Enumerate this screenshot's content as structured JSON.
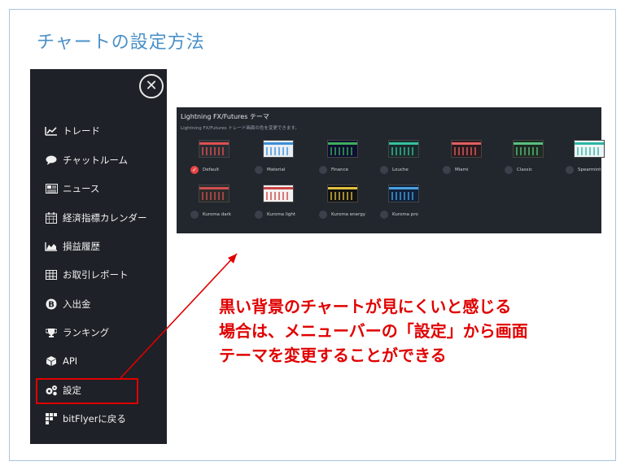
{
  "slide": {
    "title": "チャートの設定方法"
  },
  "sidebar": {
    "close_icon": "close-icon",
    "items": [
      {
        "label": "トレード",
        "icon": "chart-line-icon"
      },
      {
        "label": "チャットルーム",
        "icon": "chat-bubble-icon"
      },
      {
        "label": "ニュース",
        "icon": "newspaper-icon"
      },
      {
        "label": "経済指標カレンダー",
        "icon": "calendar-icon"
      },
      {
        "label": "損益履歴",
        "icon": "area-chart-icon"
      },
      {
        "label": "お取引レポート",
        "icon": "table-icon"
      },
      {
        "label": "入出金",
        "icon": "bitcoin-icon"
      },
      {
        "label": "ランキング",
        "icon": "trophy-icon"
      },
      {
        "label": "API",
        "icon": "cube-icon"
      },
      {
        "label": "設定",
        "icon": "gears-icon"
      },
      {
        "label": "bitFlyerに戻る",
        "icon": "bitflyer-logo-icon"
      }
    ]
  },
  "panel": {
    "title": "Lightning FX/Futures テーマ",
    "subtitle": "Lightning FX/Futures トレード画面の色を変更できます。",
    "themes": [
      {
        "label": "Default",
        "selected": true,
        "bg": "#2a2d33",
        "accent": "#e05050"
      },
      {
        "label": "Material",
        "selected": false,
        "bg": "#e8eef4",
        "accent": "#3d8fd6"
      },
      {
        "label": "Finance",
        "selected": false,
        "bg": "#0d1030",
        "accent": "#3fae5a"
      },
      {
        "label": "Louche",
        "selected": false,
        "bg": "#1a2a2a",
        "accent": "#37c0a0"
      },
      {
        "label": "Miami",
        "selected": false,
        "bg": "#2a1a1e",
        "accent": "#e06060"
      },
      {
        "label": "Classic",
        "selected": false,
        "bg": "#1f2a22",
        "accent": "#58c080"
      },
      {
        "label": "Spearmint",
        "selected": false,
        "bg": "#eef5f4",
        "accent": "#2eb5a5"
      },
      {
        "label": "Kuroma dark",
        "selected": false,
        "bg": "#2b2b2b",
        "accent": "#d05050"
      },
      {
        "label": "Kuroma light",
        "selected": false,
        "bg": "#f2f2f2",
        "accent": "#cc4444"
      },
      {
        "label": "Kuroma energy",
        "selected": false,
        "bg": "#121212",
        "accent": "#e0c040"
      },
      {
        "label": "Kuroma pro",
        "selected": false,
        "bg": "#10213a",
        "accent": "#4aa0e0"
      }
    ]
  },
  "annotation": {
    "lines": [
      "黒い背景のチャートが見にくいと感じる",
      "場合は、メニューバーの「設定」から画面",
      "テーマを変更することができる"
    ],
    "color": "#e00000"
  }
}
